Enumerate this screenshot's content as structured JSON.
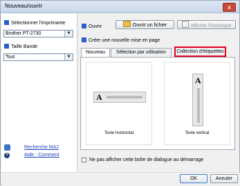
{
  "window": {
    "title": "Nouveau/ouvrir",
    "close_label": "x"
  },
  "left_panel": {
    "printer_label": "Sélectionner l'imprimante",
    "printer_value": "Brother PT-2730",
    "tape_label": "Taille Bande",
    "tape_value": "Tout",
    "update_link": "Recherche MAJ",
    "help_link": "Aide - Comment"
  },
  "top": {
    "open_label": "Ouvrir",
    "open_file_button": "Ouvrir un fichier",
    "history_button": "Afficher l'historique",
    "create_label": "Créer une nouvelle mise en page"
  },
  "tabs": [
    "Nouveau",
    "Sélection par utilisation",
    "Collection d'étiquettes"
  ],
  "tiles": {
    "horizontal": "Texte horizontal",
    "vertical": "Texte vertical",
    "glyph": "A"
  },
  "footer": {
    "checkbox_label": "Ne pas afficher cette boîte de dialogue au démarrage",
    "ok": "OK",
    "cancel": "Annuler"
  },
  "colors": {
    "accent": "#2b5ec8",
    "highlight": "#e0001b",
    "close": "#c9483a"
  }
}
